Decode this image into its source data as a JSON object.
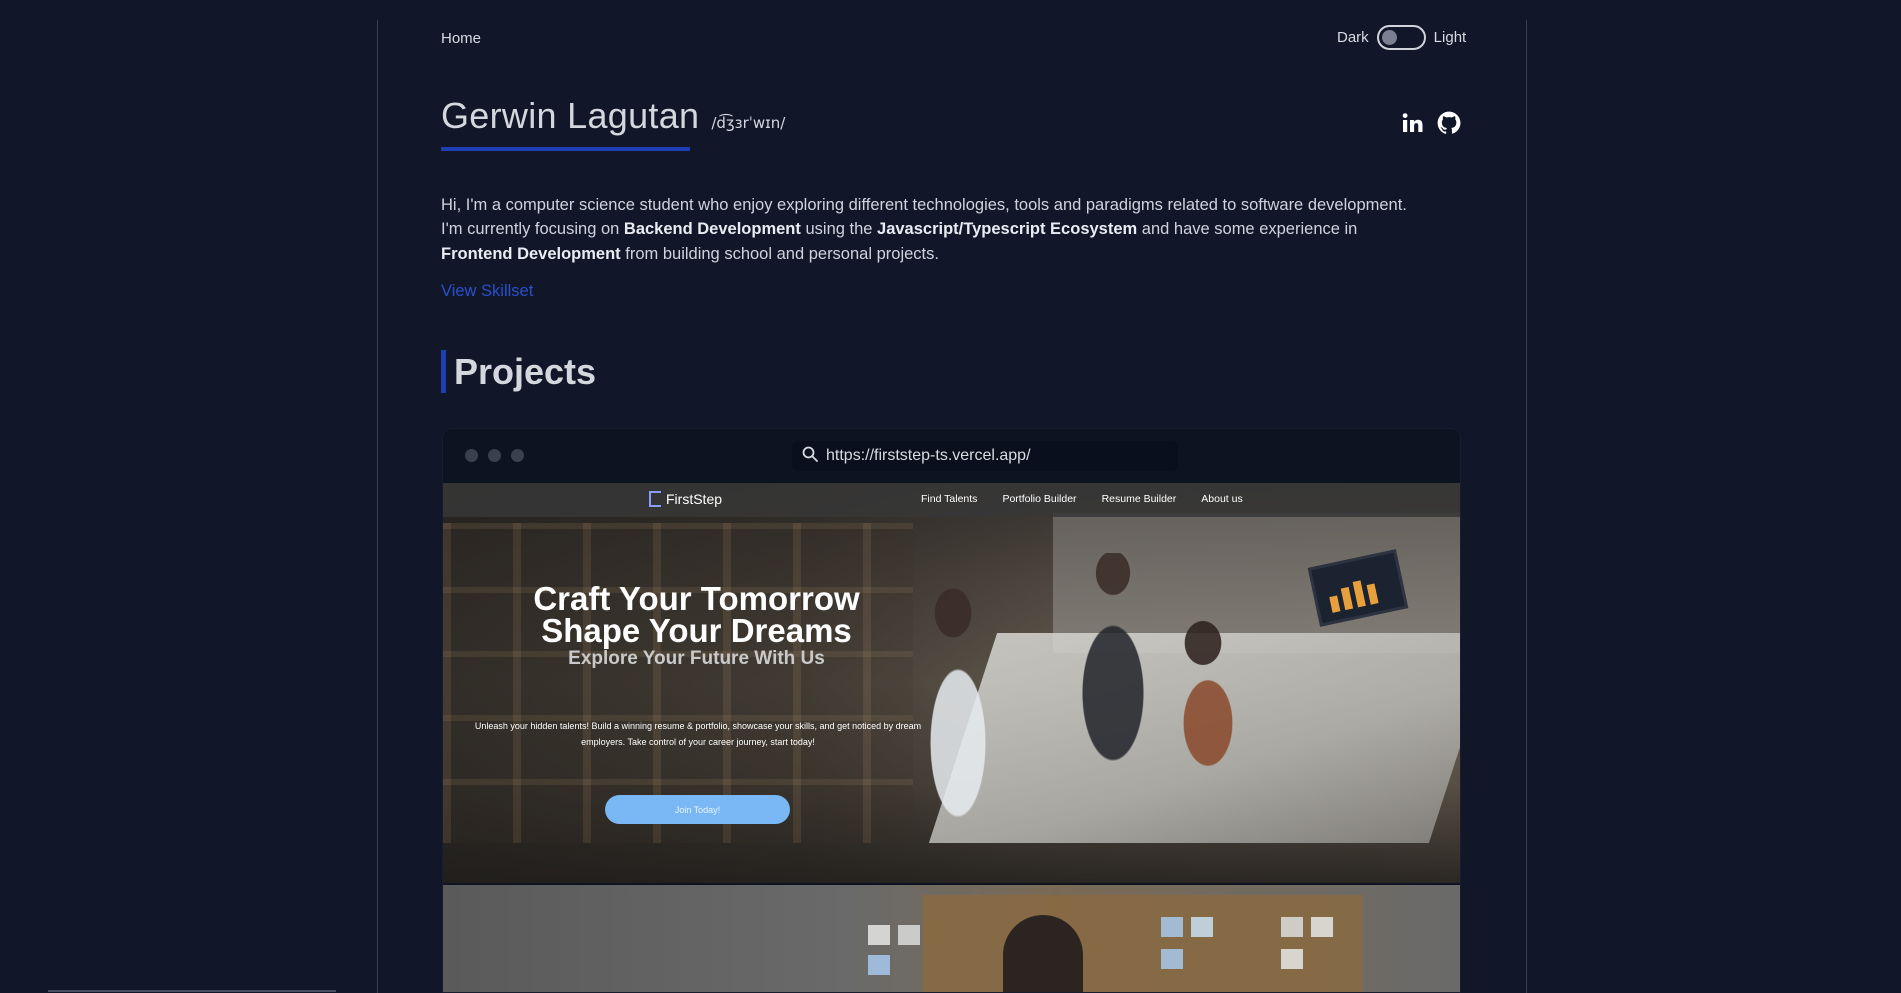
{
  "nav": {
    "home": "Home"
  },
  "theme": {
    "dark_label": "Dark",
    "light_label": "Light",
    "mode": "dark"
  },
  "profile": {
    "name": "Gerwin Lagutan",
    "phonetic": "/d͡ʒɜrˈwɪn/",
    "socials": [
      "linkedin-icon",
      "github-icon"
    ]
  },
  "bio": {
    "p1": "Hi, I'm a computer science student who enjoy exploring different technologies, tools and paradigms related to software development. I'm currently focusing on ",
    "b1": "Backend Development",
    "p2": " using the ",
    "b2": "Javascript/Typescript Ecosystem",
    "p3": " and have some experience in ",
    "b3": "Frontend Development",
    "p4": " from building school and personal projects."
  },
  "skillset_link": "View Skillset",
  "projects": {
    "heading": "Projects",
    "items": [
      {
        "url": "https://firststep-ts.vercel.app/",
        "preview": {
          "brand": "FirstStep",
          "nav_links": [
            "Find Talents",
            "Portfolio Builder",
            "Resume Builder",
            "About us"
          ],
          "title_line1": "Craft Your Tomorrow",
          "title_line2": "Shape Your Dreams",
          "subtitle": "Explore Your Future With Us",
          "description": "Unleash your hidden talents! Build a winning resume & portfolio, showcase your skills, and get noticed by dream employers. Take control of your career journey, start today!",
          "cta": "Join Today!"
        }
      }
    ]
  },
  "colors": {
    "background": "#111729",
    "accent": "#1d3fb1",
    "link": "#2a4fc9",
    "cta": "#79b8f5"
  }
}
